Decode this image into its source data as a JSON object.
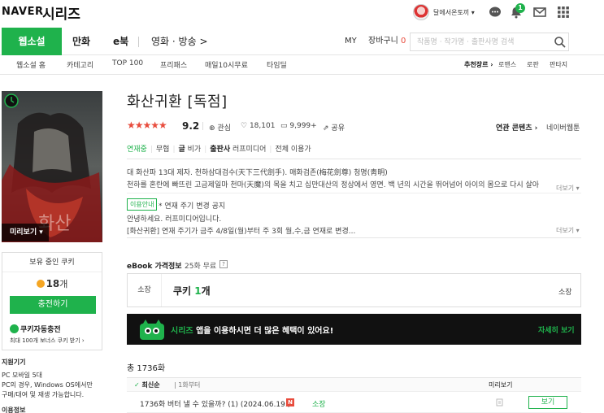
{
  "header": {
    "brand": "NAVER",
    "service": "시리즈",
    "user_name": "달에서온토끼",
    "notification_count": "1"
  },
  "nav": {
    "tabs": [
      {
        "label": "웹소설",
        "active": true
      },
      {
        "label": "만화"
      },
      {
        "label": "e북"
      },
      {
        "label": "영화 · 방송"
      }
    ],
    "my": "MY",
    "cart": "장바구니",
    "cart_count": "0",
    "search_placeholder": "작품명 · 작가명 · 출판사명 검색"
  },
  "subnav": {
    "items": [
      "웹소설 홈",
      "카테고리",
      "TOP 100",
      "프리패스",
      "매일10시무료",
      "타임딜"
    ],
    "genre_label": "추천장르",
    "genres": [
      "로맨스",
      "로판",
      "판타지"
    ]
  },
  "book": {
    "title": "화산귀환 [독점]",
    "stars": "★★★★★",
    "rating": "9.2",
    "interest": "관심",
    "likes": "18,101",
    "comments": "9,999+",
    "share": "공유",
    "related_label": "연관 콘텐츠",
    "related_value": "네이버웹툰",
    "status": "연재중",
    "free": "무협",
    "author_label": "글",
    "author": "비가",
    "publisher_label": "출판사",
    "publisher": "러프미디어",
    "age": "전체 이용가",
    "synopsis_1": "대 화산파 13대 제자. 천하삼대검수(天下三代劍手). 매화검존(梅花劍尊) 청명(靑明)",
    "synopsis_2": "천하를 혼란에 빠뜨린 고금제일마 천마(天魔)의 목을 치고 십만대산의 정상에서 영면. 백 년의 시간을 뛰어넘어 아이의 몸으로 다시 살아",
    "more": "더보기",
    "notice_tag": "이용안내",
    "notice_title": "* 연재 주기 변경 공지",
    "notice_line_1": "안녕하세요. 러프미디어입니다.",
    "notice_line_2": "[화산귀환] 연재 주기가 금주 4/8일(월)부터 주 3회 월,수,금 연재로 변경...",
    "preview_button": "미리보기"
  },
  "coin": {
    "header": "보유 중인 쿠키",
    "amount": "18",
    "unit": "개",
    "charge_button": "충전하기",
    "auto_charge": "쿠키자동충전",
    "auto_sub": "최대 100개 보너스 쿠키 받기"
  },
  "device": {
    "title": "지원기기",
    "line_1": "PC  모바일 5대",
    "line_2": "PC의 경우, Windows OS에서만",
    "line_3": "구매/대여 및 재생 가능합니다.",
    "line_4": "이용정보"
  },
  "ebook": {
    "title": "eBook 가격정보",
    "sub": "25화 무료",
    "help": "?",
    "price_label": "소장",
    "price_prefix": "쿠키",
    "price_num": "1",
    "price_unit": "개",
    "price_right": "소장"
  },
  "banner": {
    "brand": "시리즈",
    "text": " 앱을 이용하시면 더 많은 혜택이 있어요!",
    "link": "자세히 보기"
  },
  "episodes": {
    "total": "총 1736화",
    "sort": "최신순",
    "first": "1화부터",
    "preview_col": "미리보기",
    "rows": [
      {
        "title": "1736화 버터 낼 수 있을까? (1) (2024.06.19.)",
        "badge": "N",
        "own": "소장",
        "button": "보기"
      }
    ]
  }
}
